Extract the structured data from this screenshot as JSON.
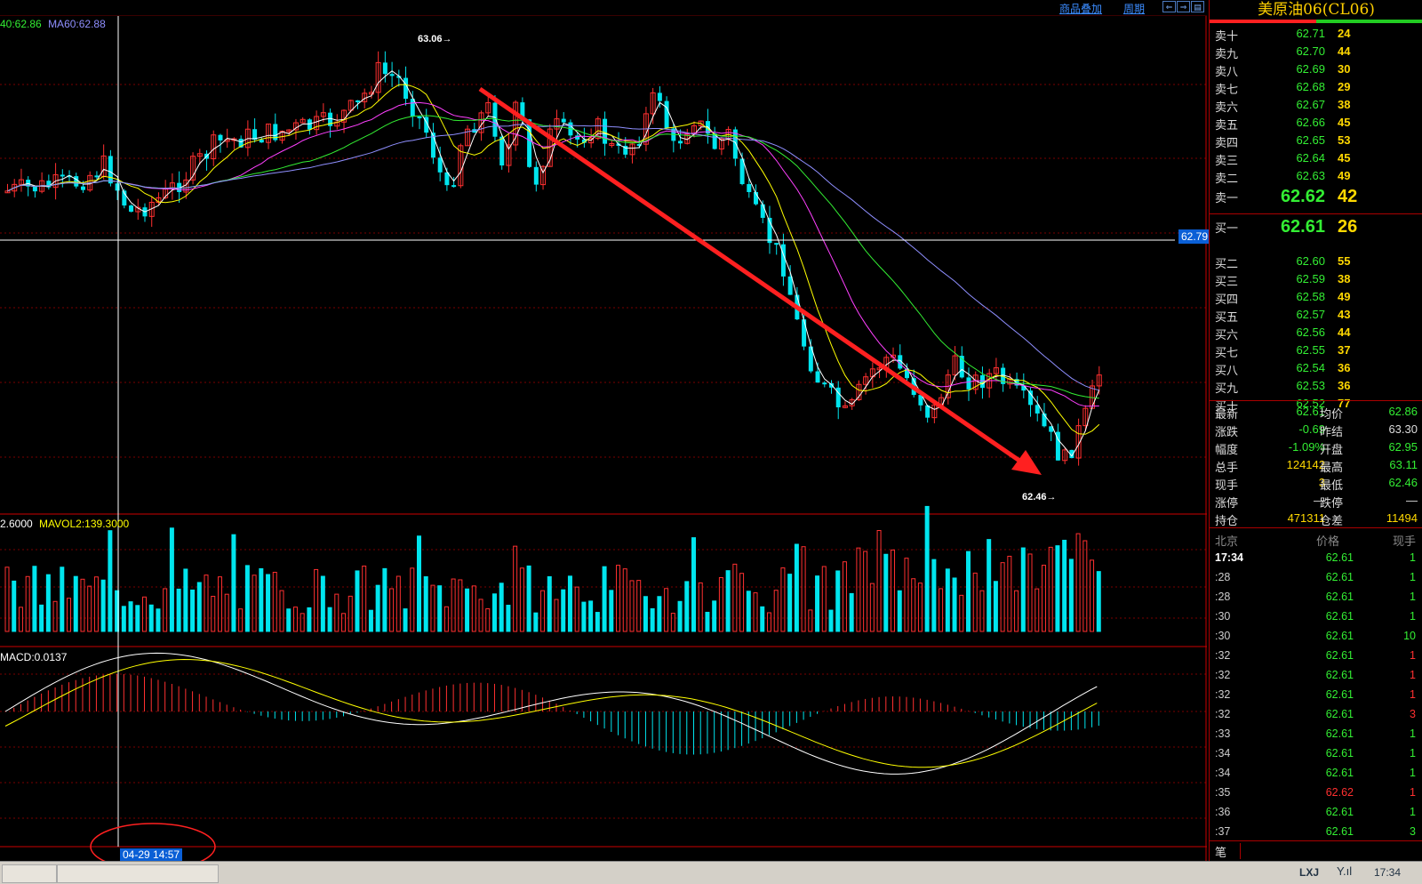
{
  "toolbar": {
    "overlay_label": "商品叠加",
    "period_label": "周期"
  },
  "legends": {
    "price_ma": [
      {
        "text": "40:62.86",
        "color": "#33ee33"
      },
      {
        "text": "MA60:62.88",
        "color": "#8f8fff"
      }
    ],
    "volume": [
      {
        "text": "2.6000",
        "color": "#ffffff"
      },
      {
        "text": "MAVOL2:139.3000",
        "color": "#ffff00"
      }
    ],
    "macd": "MACD:0.0137"
  },
  "annotations": {
    "high": "63.06",
    "low": "62.46",
    "cursor_price": "62.79",
    "cursor_time": "04-29 14:57"
  },
  "quote_panel": {
    "title": "美原油06(CL06)",
    "asks": [
      {
        "label": "卖十",
        "price": "62.71",
        "vol": "24"
      },
      {
        "label": "卖九",
        "price": "62.70",
        "vol": "44"
      },
      {
        "label": "卖八",
        "price": "62.69",
        "vol": "30"
      },
      {
        "label": "卖七",
        "price": "62.68",
        "vol": "29"
      },
      {
        "label": "卖六",
        "price": "62.67",
        "vol": "38"
      },
      {
        "label": "卖五",
        "price": "62.66",
        "vol": "45"
      },
      {
        "label": "卖四",
        "price": "62.65",
        "vol": "53"
      },
      {
        "label": "卖三",
        "price": "62.64",
        "vol": "45"
      },
      {
        "label": "卖二",
        "price": "62.63",
        "vol": "49"
      },
      {
        "label": "卖一",
        "price": "62.62",
        "vol": "42"
      }
    ],
    "bids": [
      {
        "label": "买一",
        "price": "62.61",
        "vol": "26"
      },
      {
        "label": "买二",
        "price": "62.60",
        "vol": "55"
      },
      {
        "label": "买三",
        "price": "62.59",
        "vol": "38"
      },
      {
        "label": "买四",
        "price": "62.58",
        "vol": "49"
      },
      {
        "label": "买五",
        "price": "62.57",
        "vol": "43"
      },
      {
        "label": "买六",
        "price": "62.56",
        "vol": "44"
      },
      {
        "label": "买七",
        "price": "62.55",
        "vol": "37"
      },
      {
        "label": "买八",
        "price": "62.54",
        "vol": "36"
      },
      {
        "label": "买九",
        "price": "62.53",
        "vol": "36"
      },
      {
        "label": "买十",
        "price": "62.52",
        "vol": "77"
      }
    ],
    "stats": [
      {
        "l1": "最新",
        "v1": "62.61",
        "c1": "#33ee33",
        "l2": "均价",
        "v2": "62.86",
        "c2": "#33ee33"
      },
      {
        "l1": "涨跌",
        "v1": "-0.69",
        "c1": "#33ee33",
        "l2": "昨结",
        "v2": "63.30",
        "c2": "#dddddd"
      },
      {
        "l1": "幅度",
        "v1": "-1.09%",
        "c1": "#33ee33",
        "l2": "开盘",
        "v2": "62.95",
        "c2": "#33ee33"
      },
      {
        "l1": "总手",
        "v1": "124142",
        "c1": "#ffd800",
        "l2": "最高",
        "v2": "63.11",
        "c2": "#33ee33"
      },
      {
        "l1": "现手",
        "v1": "3",
        "c1": "#ffd800",
        "l2": "最低",
        "v2": "62.46",
        "c2": "#33ee33"
      },
      {
        "l1": "涨停",
        "v1": "—",
        "c1": "#dddddd",
        "l2": "跌停",
        "v2": "—",
        "c2": "#dddddd"
      },
      {
        "l1": "持仓",
        "v1": "471311",
        "c1": "#ffd800",
        "l2": "仓差",
        "v2": "11494",
        "c2": "#ffd800"
      }
    ],
    "ticks_header": {
      "time": "北京",
      "price": "价格",
      "vol": "现手"
    },
    "ticks": [
      {
        "time": "17:34",
        "price": "62.61",
        "vol": "1",
        "vc": "#33ee33"
      },
      {
        "time": ":28",
        "price": "62.61",
        "vol": "1",
        "vc": "#33ee33"
      },
      {
        "time": ":28",
        "price": "62.61",
        "vol": "1",
        "vc": "#33ee33"
      },
      {
        "time": ":30",
        "price": "62.61",
        "vol": "1",
        "vc": "#33ee33"
      },
      {
        "time": ":30",
        "price": "62.61",
        "vol": "10",
        "vc": "#33ee33"
      },
      {
        "time": ":32",
        "price": "62.61",
        "vol": "1",
        "vc": "#ff3030"
      },
      {
        "time": ":32",
        "price": "62.61",
        "vol": "1",
        "vc": "#ff3030"
      },
      {
        "time": ":32",
        "price": "62.61",
        "vol": "1",
        "vc": "#ff3030"
      },
      {
        "time": ":32",
        "price": "62.61",
        "vol": "3",
        "vc": "#ff3030"
      },
      {
        "time": ":33",
        "price": "62.61",
        "vol": "1",
        "vc": "#33ee33"
      },
      {
        "time": ":34",
        "price": "62.61",
        "vol": "1",
        "vc": "#33ee33"
      },
      {
        "time": ":34",
        "price": "62.61",
        "vol": "1",
        "vc": "#33ee33"
      },
      {
        "time": ":35",
        "price": "62.62",
        "vol": "1",
        "vc": "#ff3030"
      },
      {
        "time": ":36",
        "price": "62.61",
        "vol": "1",
        "vc": "#33ee33"
      },
      {
        "time": ":37",
        "price": "62.61",
        "vol": "3",
        "vc": "#33ee33"
      }
    ],
    "bottom_tab": "笔"
  },
  "statusbar": {
    "brand": "LXJ",
    "signal_icon": "signal-icon",
    "clock": "17:34"
  },
  "colors": {
    "up": "#ff3030",
    "down": "#00e5ee",
    "grid": "#7a0000",
    "arrow": "#ff2020"
  }
}
